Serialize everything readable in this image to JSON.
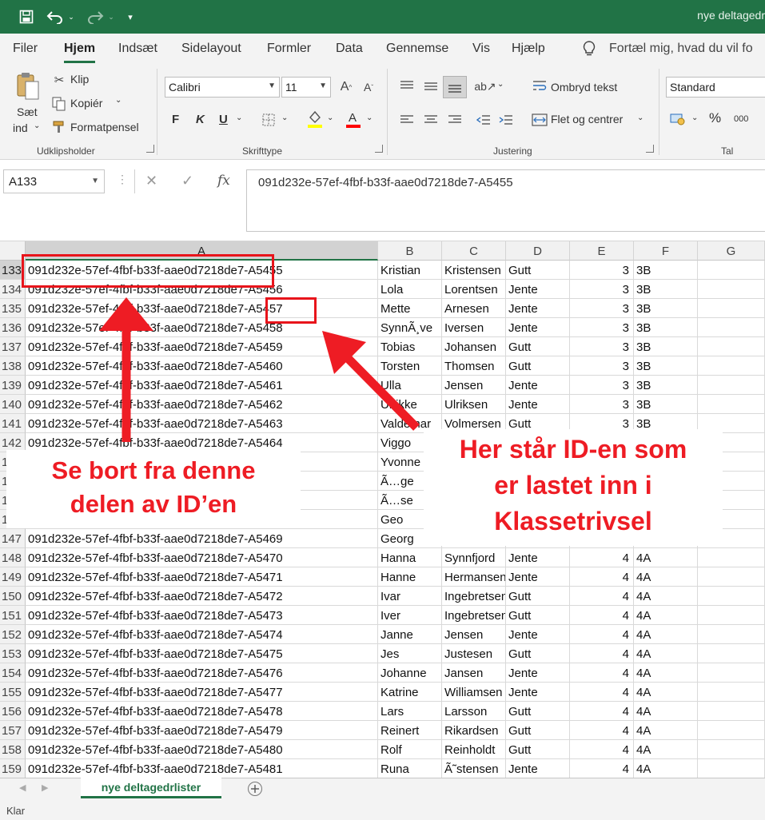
{
  "titlebar": {
    "title": "nye deltagedr",
    "icons": [
      "save-icon",
      "undo-icon",
      "redo-icon",
      "customize-icon"
    ]
  },
  "tabs": [
    "Filer",
    "Hjem",
    "Indsæt",
    "Sidelayout",
    "Formler",
    "Data",
    "Gennemse",
    "Vis",
    "Hjælp"
  ],
  "active_tab": "Hjem",
  "tell_me": "Fortæl mig, hvad du vil fo",
  "ribbon": {
    "clipboard": {
      "paste_label_1": "Sæt",
      "paste_label_2": "ind",
      "cut": "Klip",
      "copy": "Kopiér",
      "format_painter": "Formatpensel",
      "group_label": "Udklipsholder"
    },
    "font": {
      "font_name": "Calibri",
      "font_size": "11",
      "bold": "F",
      "italic": "K",
      "underline": "U",
      "group_label": "Skrifttype",
      "highlight_color": "#ffff00",
      "font_color": "#ff0000"
    },
    "alignment": {
      "wrap_text": "Ombryd tekst",
      "merge_center": "Flet og centrer",
      "group_label": "Justering"
    },
    "number": {
      "format": "Standard",
      "percent": "%",
      "thousands": "000",
      "group_label": "Tal"
    }
  },
  "formula_bar": {
    "name_box": "A133",
    "content": "091d232e-57ef-4fbf-b33f-aae0d7218de7-A5455"
  },
  "columns": [
    "A",
    "B",
    "C",
    "D",
    "E",
    "F",
    "G"
  ],
  "selected_column": "A",
  "selected_row": "133",
  "rows": [
    {
      "n": "133",
      "a": "091d232e-57ef-4fbf-b33f-aae0d7218de7-A5455",
      "b": "Kristian",
      "c": "Kristensen",
      "d": "Gutt",
      "e": "3",
      "f": "3B"
    },
    {
      "n": "134",
      "a": "091d232e-57ef-4fbf-b33f-aae0d7218de7-A5456",
      "b": "Lola",
      "c": "Lorentsen",
      "d": "Jente",
      "e": "3",
      "f": "3B"
    },
    {
      "n": "135",
      "a": "091d232e-57ef-4fbf-b33f-aae0d7218de7-A5457",
      "b": "Mette",
      "c": "Arnesen",
      "d": "Jente",
      "e": "3",
      "f": "3B"
    },
    {
      "n": "136",
      "a": "091d232e-57ef-4fbf-b33f-aae0d7218de7-A5458",
      "b": "SynnÃ¸ve",
      "c": "Iversen",
      "d": "Jente",
      "e": "3",
      "f": "3B"
    },
    {
      "n": "137",
      "a": "091d232e-57ef-4fbf-b33f-aae0d7218de7-A5459",
      "b": "Tobias",
      "c": "Johansen",
      "d": "Gutt",
      "e": "3",
      "f": "3B"
    },
    {
      "n": "138",
      "a": "091d232e-57ef-4fbf-b33f-aae0d7218de7-A5460",
      "b": "Torsten",
      "c": "Thomsen",
      "d": "Gutt",
      "e": "3",
      "f": "3B"
    },
    {
      "n": "139",
      "a": "091d232e-57ef-4fbf-b33f-aae0d7218de7-A5461",
      "b": "Ulla",
      "c": "Jensen",
      "d": "Jente",
      "e": "3",
      "f": "3B"
    },
    {
      "n": "140",
      "a": "091d232e-57ef-4fbf-b33f-aae0d7218de7-A5462",
      "b": "Ulrikke",
      "c": "Ulriksen",
      "d": "Jente",
      "e": "3",
      "f": "3B"
    },
    {
      "n": "141",
      "a": "091d232e-57ef-4fbf-b33f-aae0d7218de7-A5463",
      "b": "Valdemar",
      "c": "Volmersen",
      "d": "Gutt",
      "e": "3",
      "f": "3B"
    },
    {
      "n": "142",
      "a": "091d232e-57ef-4fbf-b33f-aae0d7218de7-A5464",
      "b": "Viggo",
      "c": "",
      "d": "",
      "e": "",
      "f": ""
    },
    {
      "n": "1",
      "a": "",
      "b": "Yvonne",
      "c": "",
      "d": "",
      "e": "",
      "f": ""
    },
    {
      "n": "1",
      "a": "",
      "b": "Ã…ge",
      "c": "",
      "d": "",
      "e": "",
      "f": ""
    },
    {
      "n": "1",
      "a": "",
      "b": "Ã…se",
      "c": "",
      "d": "",
      "e": "",
      "f": ""
    },
    {
      "n": "1",
      "a": "",
      "b": "Geo",
      "c": "",
      "d": "",
      "e": "",
      "f": ""
    },
    {
      "n": "147",
      "a": "091d232e-57ef-4fbf-b33f-aae0d7218de7-A5469",
      "b": "Georg",
      "c": "",
      "d": "",
      "e": "",
      "f": ""
    },
    {
      "n": "148",
      "a": "091d232e-57ef-4fbf-b33f-aae0d7218de7-A5470",
      "b": "Hanna",
      "c": "Synnfjord",
      "d": "Jente",
      "e": "4",
      "f": "4A"
    },
    {
      "n": "149",
      "a": "091d232e-57ef-4fbf-b33f-aae0d7218de7-A5471",
      "b": "Hanne",
      "c": "Hermansen",
      "d": "Jente",
      "e": "4",
      "f": "4A"
    },
    {
      "n": "150",
      "a": "091d232e-57ef-4fbf-b33f-aae0d7218de7-A5472",
      "b": "Ivar",
      "c": "Ingebretsen",
      "d": "Gutt",
      "e": "4",
      "f": "4A"
    },
    {
      "n": "151",
      "a": "091d232e-57ef-4fbf-b33f-aae0d7218de7-A5473",
      "b": "Iver",
      "c": "Ingebretsen",
      "d": "Gutt",
      "e": "4",
      "f": "4A"
    },
    {
      "n": "152",
      "a": "091d232e-57ef-4fbf-b33f-aae0d7218de7-A5474",
      "b": "Janne",
      "c": "Jensen",
      "d": "Jente",
      "e": "4",
      "f": "4A"
    },
    {
      "n": "153",
      "a": "091d232e-57ef-4fbf-b33f-aae0d7218de7-A5475",
      "b": "Jes",
      "c": "Justesen",
      "d": "Gutt",
      "e": "4",
      "f": "4A"
    },
    {
      "n": "154",
      "a": "091d232e-57ef-4fbf-b33f-aae0d7218de7-A5476",
      "b": "Johanne",
      "c": "Jansen",
      "d": "Jente",
      "e": "4",
      "f": "4A"
    },
    {
      "n": "155",
      "a": "091d232e-57ef-4fbf-b33f-aae0d7218de7-A5477",
      "b": "Katrine",
      "c": "Williamsen",
      "d": "Jente",
      "e": "4",
      "f": "4A"
    },
    {
      "n": "156",
      "a": "091d232e-57ef-4fbf-b33f-aae0d7218de7-A5478",
      "b": "Lars",
      "c": "Larsson",
      "d": "Gutt",
      "e": "4",
      "f": "4A"
    },
    {
      "n": "157",
      "a": "091d232e-57ef-4fbf-b33f-aae0d7218de7-A5479",
      "b": "Reinert",
      "c": "Rikardsen",
      "d": "Gutt",
      "e": "4",
      "f": "4A"
    },
    {
      "n": "158",
      "a": "091d232e-57ef-4fbf-b33f-aae0d7218de7-A5480",
      "b": "Rolf",
      "c": "Reinholdt",
      "d": "Gutt",
      "e": "4",
      "f": "4A"
    },
    {
      "n": "159",
      "a": "091d232e-57ef-4fbf-b33f-aae0d7218de7-A5481",
      "b": "Runa",
      "c": "Ã˜stensen",
      "d": "Jente",
      "e": "4",
      "f": "4A"
    }
  ],
  "sheet_tab": "nye deltagedrlister",
  "status": "Klar",
  "annotations": {
    "left_callout_line1": "Se bort fra denne",
    "left_callout_line2": "delen av ID’en",
    "right_callout_line1": "Her står ID-en som",
    "right_callout_line2": "er lastet inn i",
    "right_callout_line3": "Klassetrivsel",
    "color": "#ee1c24"
  }
}
